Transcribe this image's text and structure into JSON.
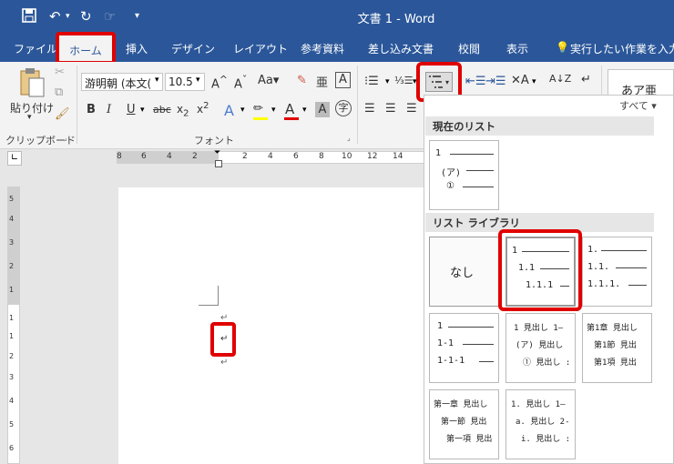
{
  "window": {
    "title": "文書 1 - Word"
  },
  "tabs": [
    "ファイル",
    "ホーム",
    "挿入",
    "デザイン",
    "レイアウト",
    "参考資料",
    "差し込み文書",
    "校閲",
    "表示",
    "実行したい作業を入力"
  ],
  "ribbon": {
    "clipboard_label": "クリップボード",
    "paste_label": "貼り付け",
    "font_label": "フォント",
    "font_name": "游明朝 (本文(",
    "font_size": "10.5",
    "styles_preview": "あア亜"
  },
  "ruler": {
    "h_numbers": [
      "8",
      "6",
      "4",
      "2",
      "2",
      "4",
      "6",
      "8",
      "10",
      "12",
      "14"
    ],
    "v_numbers": [
      "5",
      "4",
      "3",
      "2",
      "1",
      "1",
      "1",
      "2",
      "3",
      "4",
      "5",
      "6"
    ]
  },
  "gallery": {
    "all_label": "すべて",
    "current_list_heading": "現在のリスト",
    "library_heading": "リスト ライブラリ",
    "none_label": "なし",
    "current_tile": [
      "1",
      "(ア)",
      "①"
    ],
    "tiles": [
      {
        "lines": [
          "1",
          "1.1",
          "1.1.1"
        ]
      },
      {
        "lines": [
          "1.",
          "1.1.",
          "1.1.1."
        ]
      },
      {
        "lines": [
          "1",
          "1-1",
          "1-1-1"
        ]
      },
      {
        "lines": [
          "1 見出し 1—",
          "(ア) 見出し",
          "① 見出し :"
        ]
      },
      {
        "lines": [
          "第1章 見出し",
          "第1節 見出",
          "第1項 見出"
        ]
      },
      {
        "lines": [
          "第一章 見出し",
          "第一節 見出",
          "第一項 見出"
        ]
      },
      {
        "lines": [
          "1. 見出し 1—",
          "a. 見出し 2-",
          "i. 見出し :"
        ]
      }
    ]
  },
  "colors": {
    "accent": "#2b579a",
    "highlight": "#e00000"
  }
}
